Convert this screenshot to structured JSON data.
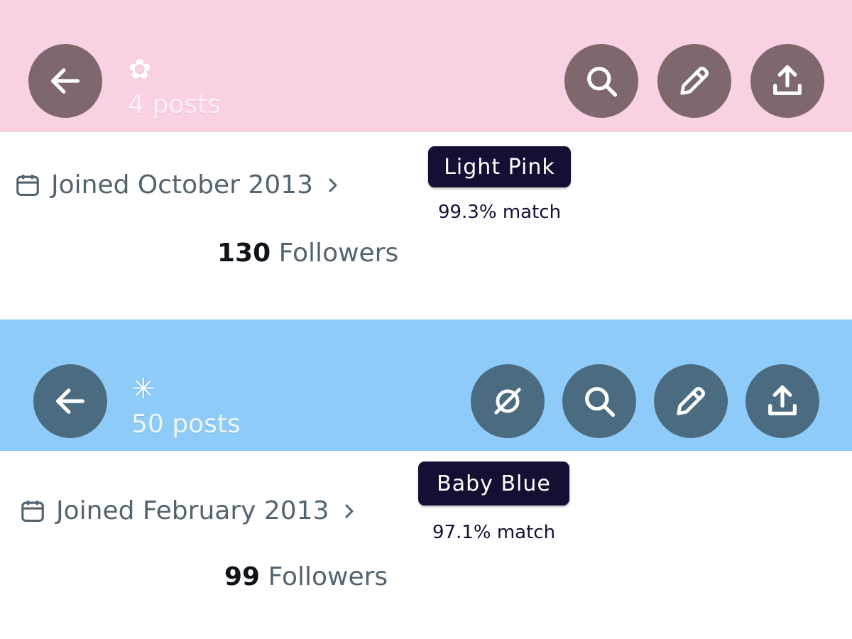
{
  "panels": [
    {
      "header_color": "#fad1e3",
      "button_color": "#7e676d",
      "posts_color": "#fdf0f5",
      "emoji": "✿",
      "posts_label": "4 posts",
      "buttons": [
        "back-arrow-icon",
        "search-icon",
        "pencil-icon",
        "share-upload-icon"
      ],
      "joined_label": "Joined October 2013",
      "followers_count": "130",
      "followers_label": "Followers",
      "color_name": "Light Pink",
      "match_label": "99.3% match"
    },
    {
      "header_color": "#8ecbf8",
      "button_color": "#4b6b80",
      "posts_color": "#eef7fd",
      "emoji": "✳",
      "posts_label": "50 posts",
      "buttons": [
        "back-arrow-icon",
        "disconnect-icon",
        "search-icon",
        "pencil-icon",
        "share-upload-icon"
      ],
      "joined_label": "Joined February 2013",
      "followers_count": "99",
      "followers_label": "Followers",
      "color_name": "Baby Blue",
      "match_label": "97.1% match"
    }
  ]
}
